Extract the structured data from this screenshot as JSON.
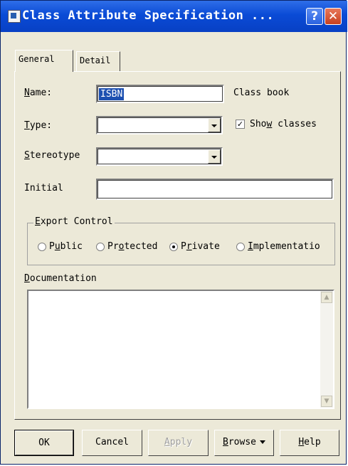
{
  "window": {
    "title": "Class Attribute Specification ...",
    "help_glyph": "?",
    "close_glyph": "✕"
  },
  "tabs": [
    {
      "label": "General",
      "active": true
    },
    {
      "label": "Detail",
      "active": false
    }
  ],
  "form": {
    "name": {
      "label_mnemonic": "N",
      "label_rest": "ame:",
      "value": "ISBN",
      "class_text": "Class book"
    },
    "type": {
      "label_mnemonic": "T",
      "label_rest": "ype:",
      "value": "",
      "show_classes_pre": "Sho",
      "show_classes_mnemonic": "w",
      "show_classes_post": " classes",
      "show_classes_checked": true,
      "check_glyph": "✓"
    },
    "stereotype": {
      "label_mnemonic": "S",
      "label_rest": "tereotype",
      "value": ""
    },
    "initial": {
      "label": "Initial",
      "value": ""
    }
  },
  "export_control": {
    "title_mnemonic": "E",
    "title_rest": "xport Control",
    "options": [
      {
        "pre": "P",
        "mnemonic": "u",
        "post": "blic",
        "selected": false
      },
      {
        "pre": "Pr",
        "mnemonic": "o",
        "post": "tected",
        "selected": false
      },
      {
        "pre": "P",
        "mnemonic": "r",
        "post": "ivate",
        "selected": true
      },
      {
        "pre": "",
        "mnemonic": "I",
        "post": "mplementatio",
        "selected": false
      }
    ]
  },
  "documentation": {
    "label_mnemonic": "D",
    "label_rest": "ocumentation",
    "value": "",
    "scroll_up_glyph": "▲",
    "scroll_down_glyph": "▼"
  },
  "buttons": {
    "ok": "OK",
    "cancel": "Cancel",
    "apply_mnemonic": "A",
    "apply_rest": "pply",
    "browse_mnemonic": "B",
    "browse_rest": "rowse",
    "help_mnemonic": "H",
    "help_rest": "elp"
  },
  "colors": {
    "titlebar": "#0a4bd6",
    "dialog_bg": "#ece9d8",
    "selection": "#1c4fb0"
  }
}
